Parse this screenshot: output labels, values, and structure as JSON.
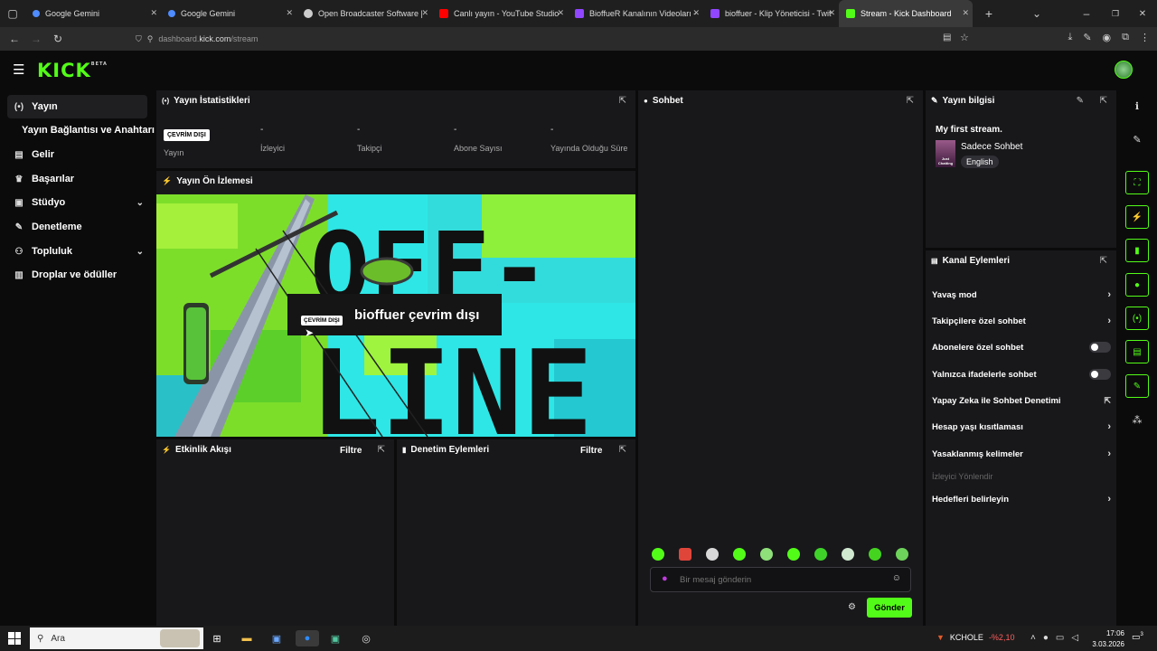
{
  "browser": {
    "tabs": [
      {
        "title": "Google Gemini",
        "favicon_color": "#4e8cff"
      },
      {
        "title": "Google Gemini",
        "favicon_color": "#4e8cff"
      },
      {
        "title": "Open Broadcaster Software | OI",
        "favicon_color": "#cccccc"
      },
      {
        "title": "Canlı yayın - YouTube Studio",
        "favicon_color": "#ff0000"
      },
      {
        "title": "BioffueR Kanalının Videoları - T",
        "favicon_color": "#9146ff"
      },
      {
        "title": "bioffuer - Klip Yöneticisi - Twitch",
        "favicon_color": "#9146ff"
      },
      {
        "title": "Stream - Kick Dashboard",
        "favicon_color": "#53fc18"
      }
    ],
    "url_host": "dashboard.",
    "url_domain": "kick.com",
    "url_path": "/stream"
  },
  "app": {
    "logo": "KICK",
    "logo_badge": "BETA"
  },
  "sidebar": {
    "items": [
      {
        "label": "Yayın",
        "icon": "broadcast-icon",
        "glyph": "(•)"
      },
      {
        "label": "Yayın Bağlantısı ve Anahtarı",
        "icon": "",
        "glyph": ""
      },
      {
        "label": "Gelir",
        "icon": "revenue-icon",
        "glyph": "▤"
      },
      {
        "label": "Başarılar",
        "icon": "trophy-icon",
        "glyph": "🏆"
      },
      {
        "label": "Stüdyo",
        "icon": "studio-icon",
        "glyph": "▣"
      },
      {
        "label": "Denetleme",
        "icon": "wrench-icon",
        "glyph": "🔧"
      },
      {
        "label": "Topluluk",
        "icon": "community-icon",
        "glyph": "👥"
      },
      {
        "label": "Droplar ve ödüller",
        "icon": "drops-icon",
        "glyph": "▥"
      }
    ]
  },
  "stats": {
    "title": "Yayın İstatistikleri",
    "status_badge": "ÇEVRİM DIŞI",
    "status_label": "Yayın",
    "items": [
      {
        "value": "-",
        "label": "İzleyici"
      },
      {
        "value": "-",
        "label": "Takipçi"
      },
      {
        "value": "-",
        "label": "Abone Sayısı"
      },
      {
        "value": "-",
        "label": "Yayında Olduğu Süre"
      }
    ]
  },
  "preview": {
    "title": "Yayın Ön İzlemesi",
    "badge": "ÇEVRİM DIŞI",
    "message": "bioffuer çevrim dışı",
    "bg_text_1": "OFF-",
    "bg_text_2": "LINE"
  },
  "activity": {
    "title": "Etkinlik Akışı",
    "filter": "Filtre"
  },
  "moderation": {
    "title": "Denetim Eylemleri",
    "filter": "Filtre"
  },
  "chat": {
    "title": "Sohbet",
    "placeholder": "Bir mesaj gönderin",
    "send": "Gönder"
  },
  "stream_info": {
    "title": "Yayın bilgisi",
    "stream_title": "My first stream.",
    "category": "Sadece Sohbet",
    "language": "English",
    "thumb_text": "Just Chatting"
  },
  "channel_actions": {
    "title": "Kanal Eylemleri",
    "items": [
      {
        "label": "Yavaş mod",
        "control": "chevron"
      },
      {
        "label": "Takipçilere özel sohbet",
        "control": "chevron"
      },
      {
        "label": "Abonelere özel sohbet",
        "control": "toggle"
      },
      {
        "label": "Yalnızca ifadelerle sohbet",
        "control": "toggle"
      },
      {
        "label": "Yapay Zeka ile Sohbet Denetimi",
        "control": "external"
      },
      {
        "label": "Hesap yaşı kısıtlaması",
        "control": "chevron"
      },
      {
        "label": "Yasaklanmış kelimeler",
        "control": "chevron"
      },
      {
        "label": "İzleyici Yönlendir",
        "control": "disabled"
      },
      {
        "label": "Hedefleri belirleyin",
        "control": "chevron"
      }
    ]
  },
  "taskbar": {
    "search": "Ara",
    "stock_name": "KCHOLE",
    "stock_change": "-%2,10",
    "time": "17:06",
    "date": "3.03.2026",
    "notif_count": "3"
  },
  "colors": {
    "accent": "#53fc18",
    "panel": "#18181b",
    "bg": "#0b0b0c"
  }
}
